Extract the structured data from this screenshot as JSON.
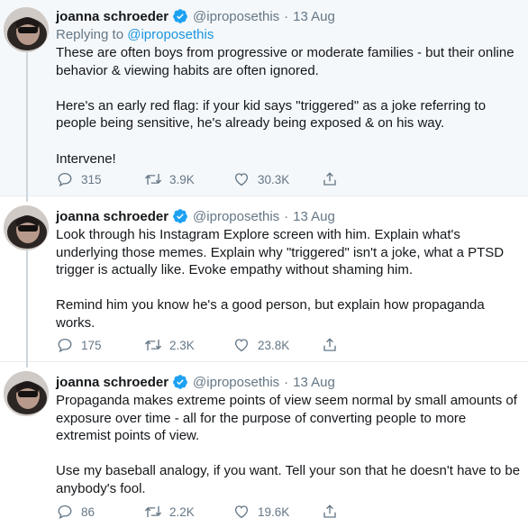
{
  "tweets": [
    {
      "author": {
        "name": "joanna schroeder",
        "handle": "@iproposethis",
        "verified": true
      },
      "date": "13 Aug",
      "replying_to": {
        "prefix": "Replying to",
        "handle": "@iproposethis"
      },
      "paragraphs": [
        "These are often boys from progressive or moderate families - but their online behavior & viewing habits are often ignored.",
        "Here's an early red flag: if your kid says \"triggered\" as a joke referring to people being sensitive, he's already being exposed & on his way.",
        "Intervene!"
      ],
      "replies": "315",
      "retweets": "3.9K",
      "likes": "30.3K"
    },
    {
      "author": {
        "name": "joanna schroeder",
        "handle": "@iproposethis",
        "verified": true
      },
      "date": "13 Aug",
      "paragraphs": [
        "Look through his Instagram Explore screen with him. Explain what's underlying those memes. Explain why \"triggered\" isn't a joke, what a PTSD trigger is actually like. Evoke empathy without shaming him.",
        "Remind him you know he's a good person, but explain how propaganda works."
      ],
      "replies": "175",
      "retweets": "2.3K",
      "likes": "23.8K"
    },
    {
      "author": {
        "name": "joanna schroeder",
        "handle": "@iproposethis",
        "verified": true
      },
      "date": "13 Aug",
      "paragraphs": [
        "Propaganda makes extreme points of view seem normal by small amounts of exposure over time - all for the purpose of converting people to more extremist points of view.",
        "Use my baseball analogy, if you want. Tell your son that he doesn't have to be anybody's fool."
      ],
      "replies": "86",
      "retweets": "2.2K",
      "likes": "19.6K"
    }
  ],
  "separator": "·",
  "colors": {
    "accent": "#1da1f2",
    "muted": "#657786",
    "text": "#14171a",
    "highlight_bg": "#f5f8fa"
  },
  "icons": [
    "verified-badge-icon",
    "reply-icon",
    "retweet-icon",
    "like-icon",
    "share-icon"
  ]
}
